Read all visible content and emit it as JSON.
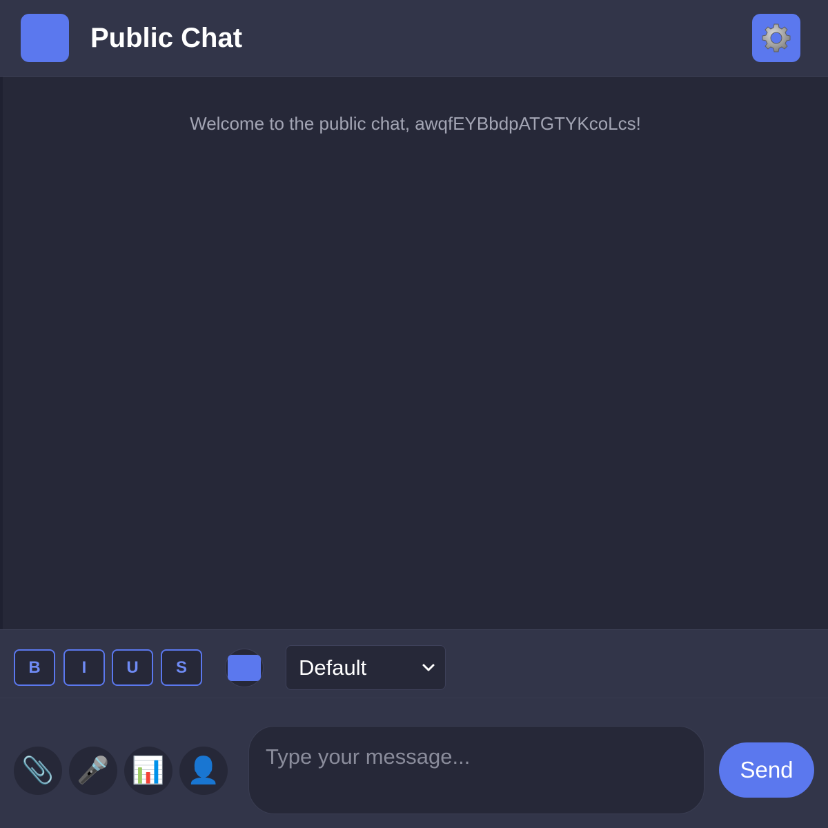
{
  "header": {
    "title": "Public Chat",
    "settings_icon": "gear-icon"
  },
  "messages": {
    "welcome": "Welcome to the public chat, awqfEYBbdpATGTYKcoLcs!"
  },
  "formatting": {
    "bold": "B",
    "italic": "I",
    "underline": "U",
    "strike": "S",
    "color": "#5b78ee",
    "font_value": "Default"
  },
  "input": {
    "tools": [
      {
        "icon": "paperclip-icon",
        "glyph": "📎"
      },
      {
        "icon": "microphone-icon",
        "glyph": "🎤"
      },
      {
        "icon": "bar-chart-icon",
        "glyph": "📊"
      },
      {
        "icon": "user-icon",
        "glyph": "👤"
      }
    ],
    "placeholder": "Type your message...",
    "send_label": "Send"
  },
  "colors": {
    "accent": "#5b78ee",
    "background": "#262838",
    "panel": "#323549"
  }
}
